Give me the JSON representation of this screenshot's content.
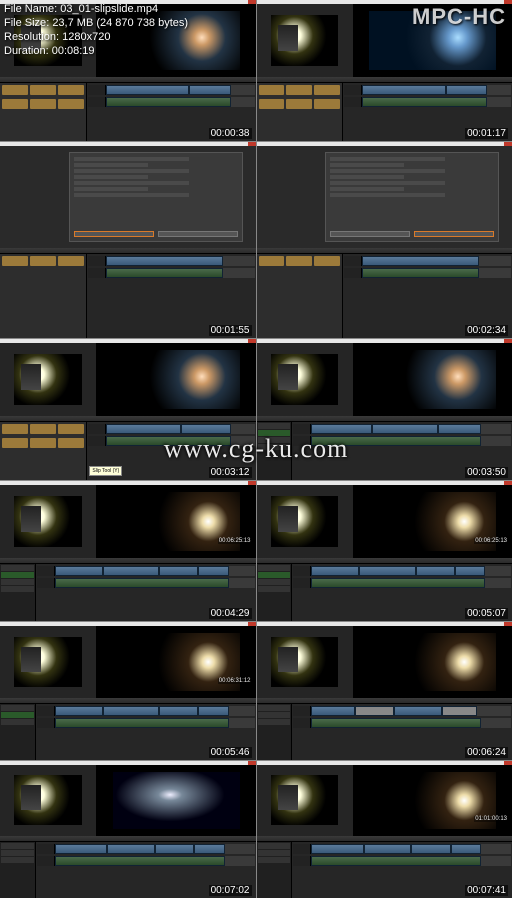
{
  "player": {
    "app_name": "MPC-HC",
    "file_info": {
      "file_name_label": "File Name",
      "file_name": "03_01-slipslide.mp4",
      "file_size_label": "File Size",
      "file_size": "23,7 MB (24 870 738 bytes)",
      "resolution_label": "Resolution",
      "resolution": "1280x720",
      "duration_label": "Duration",
      "duration": "00:08:19"
    }
  },
  "watermark": "www.cg-ku.com",
  "thumbnails": [
    {
      "timestamp": "00:00:38",
      "type": "editor",
      "program": "dancer"
    },
    {
      "timestamp": "00:01:17",
      "type": "editor",
      "program": "dancer-blue"
    },
    {
      "timestamp": "00:01:55",
      "type": "dialog"
    },
    {
      "timestamp": "00:02:34",
      "type": "dialog"
    },
    {
      "timestamp": "00:03:12",
      "type": "editor",
      "program": "dancer",
      "tooltip": true
    },
    {
      "timestamp": "00:03:50",
      "type": "editor",
      "program": "dancer"
    },
    {
      "timestamp": "00:04:29",
      "type": "editor-timeline",
      "program": "dancer-side",
      "tc": "00:06:25:13"
    },
    {
      "timestamp": "00:05:07",
      "type": "editor-timeline",
      "program": "dancer-side",
      "tc": "00:06:25:13"
    },
    {
      "timestamp": "00:05:46",
      "type": "editor-timeline",
      "program": "dancer-side",
      "tc": "00:06:31:12"
    },
    {
      "timestamp": "00:06:24",
      "type": "editor-timeline",
      "program": "dancer-side"
    },
    {
      "timestamp": "00:07:02",
      "type": "editor-timeline",
      "program": "silhouette"
    },
    {
      "timestamp": "00:07:41",
      "type": "editor-timeline",
      "program": "dancer-side",
      "tc": "01:01:00:13"
    }
  ]
}
